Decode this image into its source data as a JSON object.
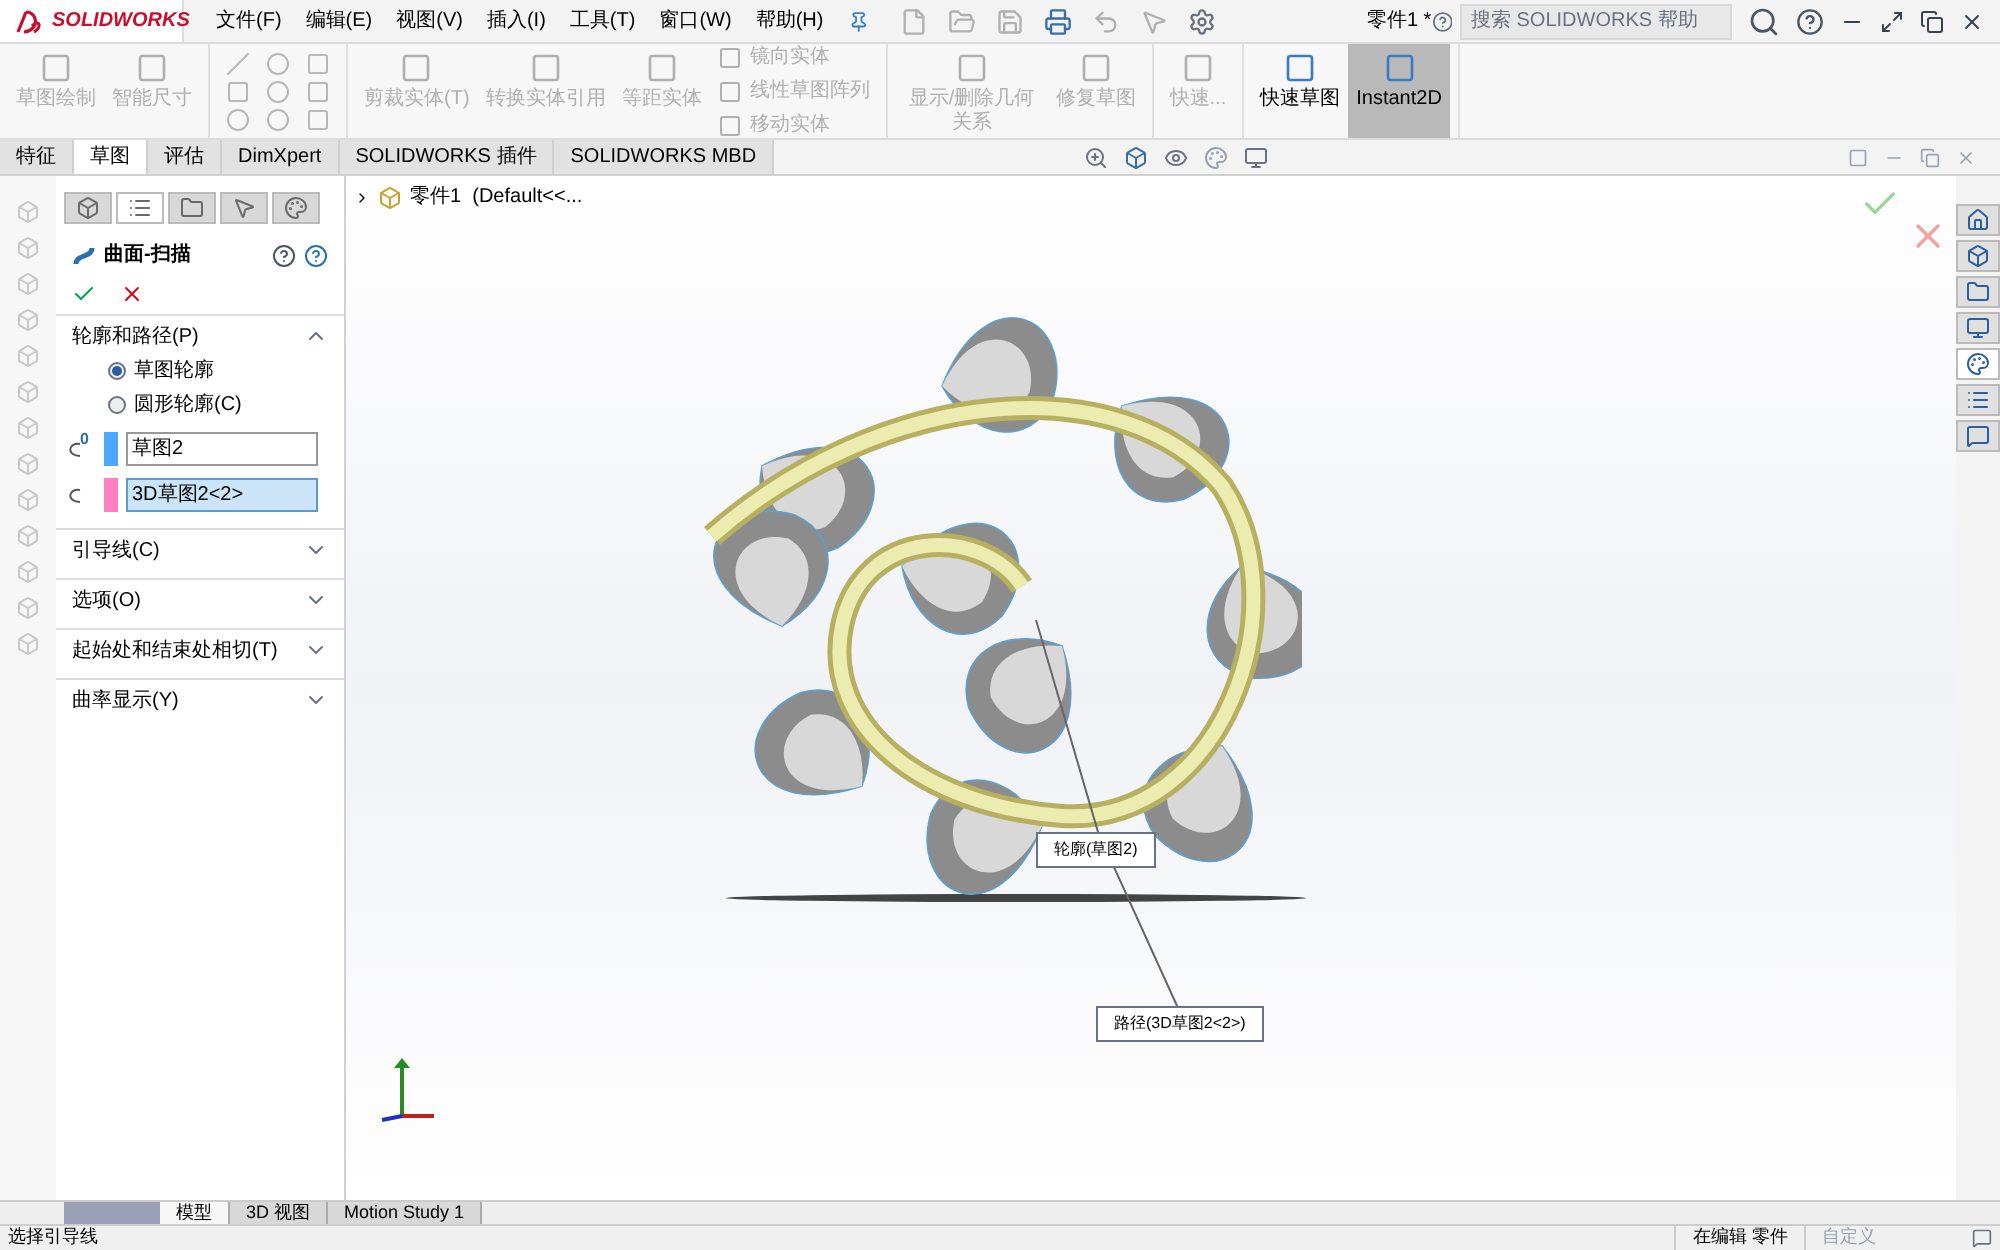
{
  "title_bar": {
    "logo": "SOLIDWORKS",
    "menu": [
      "文件(F)",
      "编辑(E)",
      "视图(V)",
      "插入(I)",
      "工具(T)",
      "窗口(W)",
      "帮助(H)"
    ],
    "document_title": "零件1 *",
    "search": {
      "placeholder": "搜索 SOLIDWORKS 帮助"
    }
  },
  "ribbon": {
    "groups": [
      {
        "commands": [
          {
            "kind": "large",
            "label": "草图绘制",
            "disabled": true,
            "selected": false
          },
          {
            "kind": "large",
            "label": "智能尺寸",
            "disabled": true,
            "selected": false
          }
        ]
      },
      {
        "kind": "tools"
      },
      {
        "commands": [
          {
            "kind": "large",
            "label": "剪裁实体(T)",
            "disabled": true,
            "selected": false
          },
          {
            "kind": "large",
            "label": "转换实体引用",
            "disabled": true,
            "selected": false
          },
          {
            "kind": "large",
            "label": "等距实体",
            "disabled": true,
            "selected": false
          },
          {
            "kind": "small",
            "label": "镜向实体",
            "disabled": true,
            "selected": false
          },
          {
            "kind": "small",
            "label": "线性草图阵列",
            "disabled": true,
            "selected": false
          },
          {
            "kind": "small",
            "label": "移动实体",
            "disabled": true,
            "selected": false
          }
        ]
      },
      {
        "commands": [
          {
            "kind": "large",
            "label": "显示/删除几何关系",
            "disabled": true,
            "selected": false
          },
          {
            "kind": "large",
            "label": "修复草图",
            "disabled": true,
            "selected": false
          }
        ]
      },
      {
        "commands": [
          {
            "kind": "large",
            "label": "快速...",
            "disabled": true,
            "selected": false
          }
        ]
      },
      {
        "commands": [
          {
            "kind": "large",
            "label": "快速草图",
            "disabled": false,
            "selected": false
          },
          {
            "kind": "large",
            "label": "Instant2D",
            "disabled": false,
            "selected": true
          }
        ]
      }
    ]
  },
  "tabs": [
    {
      "label": "特征",
      "selected": false
    },
    {
      "label": "草图",
      "selected": true
    },
    {
      "label": "评估",
      "selected": false
    },
    {
      "label": "DimXpert",
      "selected": false
    },
    {
      "label": "SOLIDWORKS 插件",
      "selected": false
    },
    {
      "label": "SOLIDWORKS MBD",
      "selected": false
    }
  ],
  "property_manager": {
    "panel_tabs": [
      {
        "selected": false
      },
      {
        "selected": true
      },
      {
        "selected": false
      },
      {
        "selected": false
      },
      {
        "selected": false
      }
    ],
    "title": "曲面-扫描",
    "sections": [
      {
        "title": "轮廓和路径(P)",
        "expanded": true
      },
      {
        "title": "引导线(C)",
        "expanded": false
      },
      {
        "title": "选项(O)",
        "expanded": false
      },
      {
        "title": "起始处和结束处相切(T)",
        "expanded": false
      },
      {
        "title": "曲率显示(Y)",
        "expanded": false
      }
    ],
    "radios": [
      {
        "label": "草图轮廓",
        "selected": true
      },
      {
        "label": "圆形轮廓(C)",
        "selected": false
      }
    ],
    "fields": [
      {
        "value": "草图2",
        "color": "#4da6ff",
        "selected": false,
        "badge": "0"
      },
      {
        "value": "3D草图2<2>",
        "color": "#ff80c0",
        "selected": true
      }
    ]
  },
  "feature_tree": {
    "label": "零件1  (Default<<...",
    "expanded": false
  },
  "task_pane": [
    {
      "selected": false
    },
    {
      "selected": false
    },
    {
      "selected": false
    },
    {
      "selected": false
    },
    {
      "selected": true
    },
    {
      "selected": false
    },
    {
      "selected": false
    }
  ],
  "callouts": [
    {
      "label": "轮廓(草图2)"
    },
    {
      "label": "路径(3D草图2<2>)"
    }
  ],
  "bottom_tabs": [
    {
      "label": "模型",
      "selected": true
    },
    {
      "label": "3D 视图",
      "selected": false
    },
    {
      "label": "Motion Study 1",
      "selected": false
    }
  ],
  "status_bar": {
    "message": "选择引导线",
    "mode": "在编辑 零件",
    "units": "自定义"
  }
}
